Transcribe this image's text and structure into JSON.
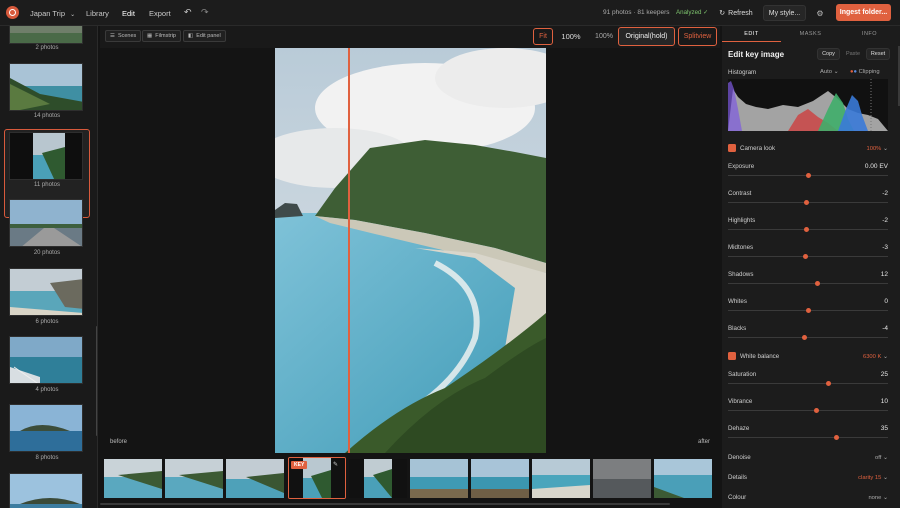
{
  "app": {
    "project_name": "Japan Trip"
  },
  "nav": {
    "library": "Library",
    "edit": "Edit",
    "export": "Export"
  },
  "status": {
    "counts": "91 photos · 81 keepers",
    "analyzed": "Analyzed ✓"
  },
  "header": {
    "refresh": "Refresh",
    "my_style": "My style...",
    "ingest": "Ingest folder..."
  },
  "sidebar": {
    "groups": [
      {
        "caption": "2 photos"
      },
      {
        "caption": "14 photos"
      },
      {
        "caption": "11 photos"
      },
      {
        "caption": "20 photos"
      },
      {
        "caption": "6 photos"
      },
      {
        "caption": "4 photos"
      },
      {
        "caption": "8 photos"
      }
    ]
  },
  "toolbar": {
    "scenes": "Scenes",
    "filmstrip": "Filmstrip",
    "edit_panel": "Edit panel",
    "fit": "Fit",
    "zoom": "100%",
    "zoom2": "100%",
    "original": "Original(hold)",
    "splitview": "Splitview"
  },
  "viewer": {
    "before": "before",
    "after": "after"
  },
  "filmstrip": {
    "key_badge": "KEY"
  },
  "panel": {
    "tabs": [
      "EDIT",
      "MASKS",
      "INFO"
    ],
    "title": "Edit key image",
    "copy": "Copy",
    "paste": "Paste",
    "reset": "Reset",
    "histogram": {
      "label": "Histogram",
      "mode": "Auto",
      "clipping": "Clipping"
    },
    "camera_look": {
      "label": "Camera look",
      "value": "100%"
    },
    "tone": [
      {
        "label": "Exposure",
        "value": "0.00 EV",
        "level": 0.5
      },
      {
        "label": "Contrast",
        "value": "-2",
        "level": 0.49
      },
      {
        "label": "Highlights",
        "value": "-2",
        "level": 0.49
      },
      {
        "label": "Midtones",
        "value": "-3",
        "level": 0.485
      },
      {
        "label": "Shadows",
        "value": "12",
        "level": 0.56
      },
      {
        "label": "Whites",
        "value": "0",
        "level": 0.5
      },
      {
        "label": "Blacks",
        "value": "-4",
        "level": 0.48
      }
    ],
    "white_balance": {
      "label": "White balance",
      "value": "6300 K"
    },
    "color": [
      {
        "label": "Saturation",
        "value": "25",
        "level": 0.625
      },
      {
        "label": "Vibrance",
        "value": "10",
        "level": 0.55
      },
      {
        "label": "Dehaze",
        "value": "35",
        "level": 0.675
      }
    ],
    "denoise": {
      "label": "Denoise",
      "value": "off"
    },
    "details": {
      "label": "Details",
      "value": "clarity 15"
    },
    "colour": {
      "label": "Colour",
      "value": "none"
    }
  },
  "colors": {
    "accent": "#e0613f",
    "bg": "#141414",
    "panel": "#1c1c1c"
  }
}
